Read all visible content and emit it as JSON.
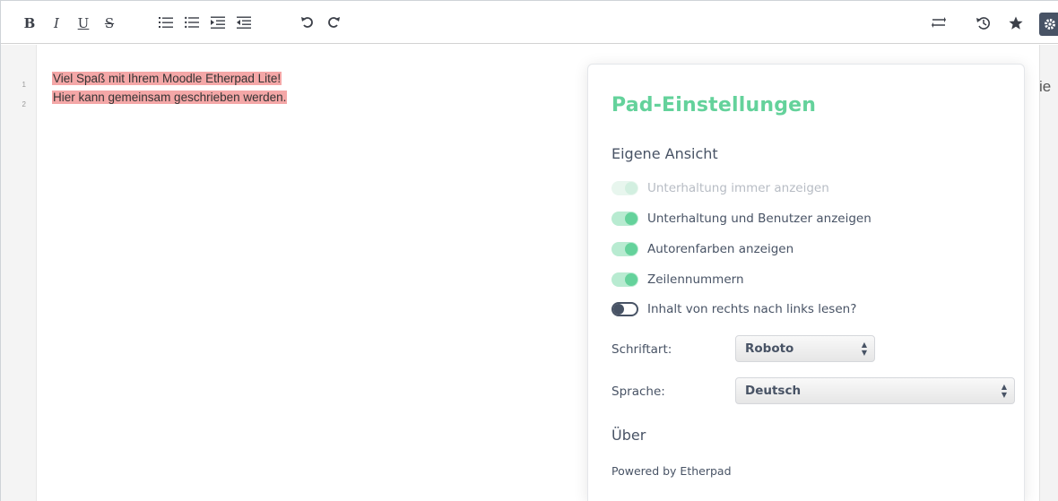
{
  "toolbar": {
    "bold": "B",
    "italic": "I",
    "underline": "U",
    "strikethrough": "S",
    "right_icons": [
      "swap-icon",
      "history-icon",
      "star-icon",
      "settings-icon"
    ]
  },
  "editor": {
    "line_numbers": [
      "1",
      "2"
    ],
    "lines": [
      "Viel Spaß mit Ihrem Moodle Etherpad Lite!",
      "Hier kann gemeinsam geschrieben werden."
    ],
    "author_color": "#f4a7a7"
  },
  "background_fragment": "ie",
  "settings": {
    "title": "Pad-Einstellungen",
    "section_own_view": "Eigene Ansicht",
    "options": [
      {
        "label": "Unterhaltung immer anzeigen",
        "state": "disabled-on"
      },
      {
        "label": "Unterhaltung und Benutzer anzeigen",
        "state": "on"
      },
      {
        "label": "Autorenfarben anzeigen",
        "state": "on"
      },
      {
        "label": "Zeilennummern",
        "state": "on"
      },
      {
        "label": "Inhalt von rechts nach links lesen?",
        "state": "off"
      }
    ],
    "font_label": "Schriftart:",
    "font_value": "Roboto",
    "language_label": "Sprache:",
    "language_value": "Deutsch",
    "about_title": "Über",
    "powered_by": "Powered by Etherpad",
    "accent_color": "#64d29b"
  }
}
